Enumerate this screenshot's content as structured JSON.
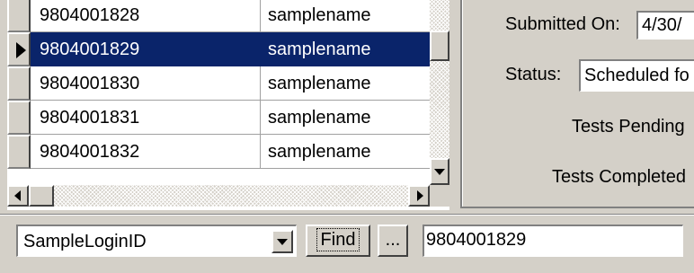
{
  "grid": {
    "rows": [
      {
        "id": "9804001828",
        "name": "samplename",
        "selected": false
      },
      {
        "id": "9804001829",
        "name": "samplename",
        "selected": true
      },
      {
        "id": "9804001830",
        "name": "samplename",
        "selected": false
      },
      {
        "id": "9804001831",
        "name": "samplename",
        "selected": false
      },
      {
        "id": "9804001832",
        "name": "samplename",
        "selected": false
      }
    ]
  },
  "details": {
    "submitted_label": "Submitted On:",
    "submitted_value": "4/30/",
    "status_label": "Status:",
    "status_value": "Scheduled fo",
    "tests_pending_label": "Tests Pending",
    "tests_completed_label": "Tests Completed"
  },
  "search": {
    "field_value": "SampleLoginID",
    "find_label": "Find",
    "more_label": "...",
    "query_value": "9804001829"
  },
  "colors": {
    "selection": "#0a246a",
    "face": "#d4d0c8"
  }
}
